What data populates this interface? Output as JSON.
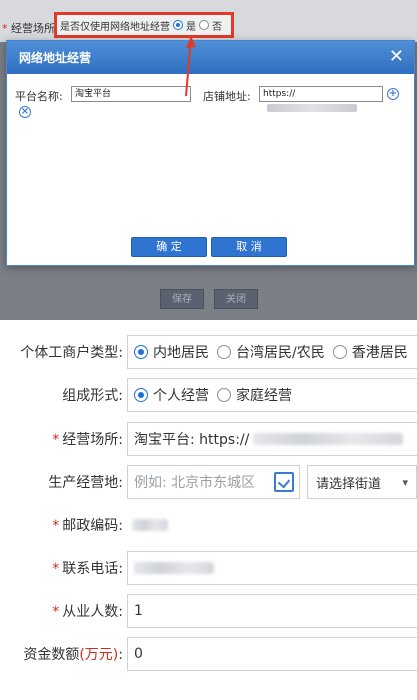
{
  "background": {
    "field_label": "经营场所",
    "question": "是否仅使用网络地址经营",
    "yes": "是",
    "no": "否",
    "save": "保存",
    "close": "关闭"
  },
  "modal": {
    "title": "网络地址经营",
    "close_glyph": "✕",
    "platform_label": "平台名称:",
    "platform_value": "淘宝平台",
    "store_label": "店铺地址:",
    "store_value": "https://",
    "add_glyph": "+",
    "remove_glyph": "×",
    "confirm": "确 定",
    "cancel": "取 消"
  },
  "form": {
    "type_label": "个体工商户类型:",
    "type_options": [
      "内地居民",
      "台湾居民/农民",
      "香港居民"
    ],
    "composition_label": "组成形式:",
    "composition_options": [
      "个人经营",
      "家庭经营"
    ],
    "location_label": "经营场所:",
    "location_value": "淘宝平台: https://",
    "production_label": "生产经营地:",
    "production_placeholder": "例如: 北京市东城区",
    "street_select": "请选择街道",
    "postal_label": "邮政编码:",
    "phone_label": "联系电话:",
    "staff_label": "从业人数:",
    "staff_value": "1",
    "capital_label": "资金数额",
    "capital_unit": "(万元)",
    "capital_colon": ":",
    "capital_value": "0",
    "required_mark": "*"
  },
  "colors": {
    "accent": "#2f74d0",
    "highlight": "#e03a2a",
    "required": "#d9281c"
  }
}
